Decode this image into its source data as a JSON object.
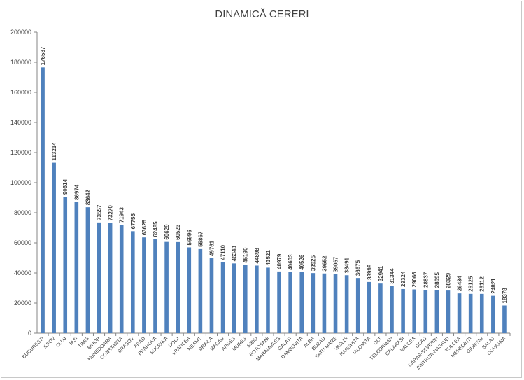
{
  "chart_data": {
    "type": "bar",
    "title": "DINAMICĂ CERERI",
    "categories": [
      "BUCURESTI",
      "ILFOV",
      "CLUJ",
      "IASI",
      "TIMIS",
      "BIHOR",
      "HUNEDOARA",
      "CONSTANTA",
      "BRASOV",
      "ARAD",
      "PRAHOVA",
      "SUCEAVA",
      "DOLJ",
      "VRANCEA",
      "NEAMT",
      "BRAILA",
      "BACAU",
      "ARGES",
      "MURES",
      "SIBIU",
      "BOTOSANI",
      "MARAMURES",
      "GALATI",
      "DAMBOVITA",
      "ALBA",
      "BUZAU",
      "SATU MARE",
      "VASLUI",
      "HARGHITA",
      "IALOMITA",
      "OLT",
      "TELEORMAN",
      "CALARASI",
      "VALCEA",
      "GORJ",
      "CARAS-SEVERIN",
      "BISTRITA-NASAUD",
      "TULCEA",
      "MEHEDINTI",
      "GIURGIU",
      "SALAJ",
      "COVASNA"
    ],
    "values": [
      176587,
      113214,
      90614,
      86974,
      83642,
      73557,
      73270,
      71943,
      67755,
      63625,
      62485,
      60629,
      60523,
      56996,
      55867,
      49761,
      47110,
      46343,
      45190,
      44898,
      43521,
      40979,
      40603,
      40526,
      39925,
      39652,
      39067,
      38491,
      36675,
      33999,
      32941,
      31344,
      29324,
      29066,
      28837,
      28695,
      28329,
      26434,
      26125,
      26112,
      24821,
      18378
    ],
    "ylim": [
      0,
      200000
    ],
    "yticks": [
      0,
      20000,
      40000,
      60000,
      80000,
      100000,
      120000,
      140000,
      160000,
      180000,
      200000
    ],
    "xlabel": "",
    "ylabel": "",
    "bar_color": "#4f81bd",
    "axis_color": "#868686",
    "grid": false,
    "legend": "none"
  }
}
